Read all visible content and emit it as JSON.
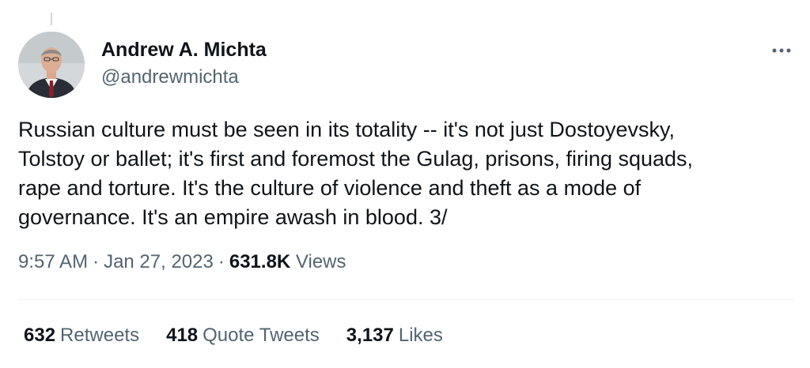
{
  "author": {
    "display_name": "Andrew A. Michta",
    "handle": "@andrewmichta"
  },
  "tweet": {
    "text": "Russian culture must be seen in its totality -- it's not just Dostoyevsky,\nTolstoy or ballet; it's first and foremost the Gulag, prisons, firing squads,\nrape and torture.  It's the culture of violence and theft as a mode of\ngovernance.  It's an empire awash in blood. 3/"
  },
  "meta": {
    "time": "9:57 AM",
    "separator": "·",
    "date": "Jan 27, 2023",
    "views_count": "631.8K",
    "views_label": "Views"
  },
  "stats": {
    "retweets_count": "632",
    "retweets_label": "Retweets",
    "quotes_count": "418",
    "quotes_label": "Quote Tweets",
    "likes_count": "3,137",
    "likes_label": "Likes"
  },
  "icons": {
    "more": "more-options-icon",
    "avatar": "profile-photo"
  },
  "colors": {
    "text_primary": "#0f1419",
    "text_secondary": "#536471",
    "divider": "#eff3f4"
  }
}
